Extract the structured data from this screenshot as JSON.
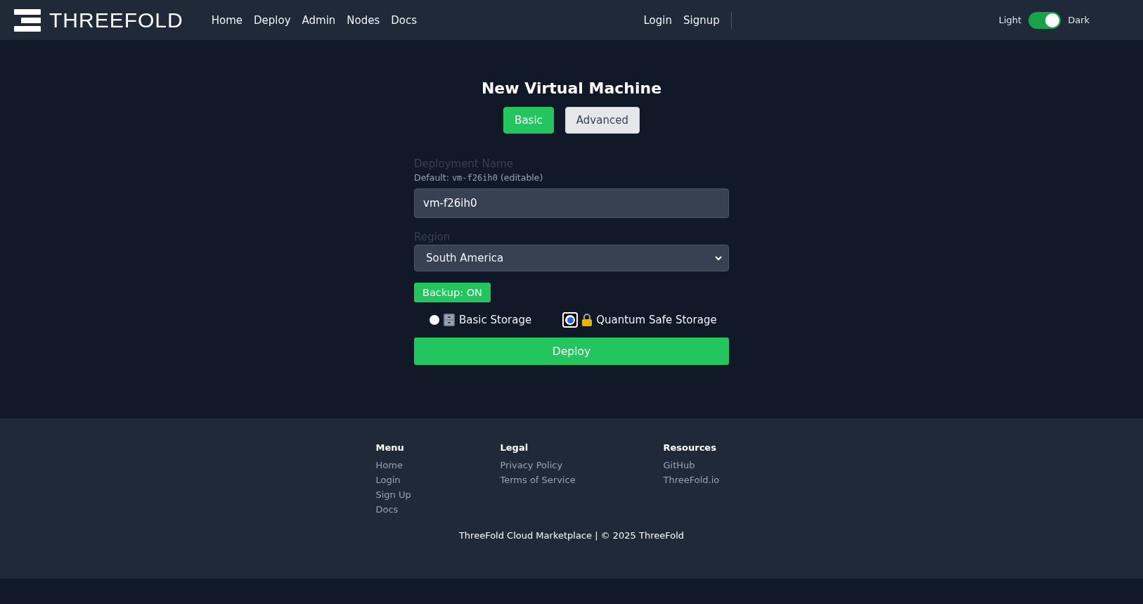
{
  "header": {
    "logo_text": "THREEFOLD",
    "nav": [
      "Home",
      "Deploy",
      "Admin",
      "Nodes",
      "Docs"
    ],
    "auth_links": [
      "Login",
      "Signup"
    ],
    "theme_toggle": {
      "light_label": "Light",
      "dark_label": "Dark",
      "on": true
    }
  },
  "form": {
    "title": "New Virtual Machine",
    "tabs": [
      {
        "label": "Basic",
        "selected": true
      },
      {
        "label": "Advanced",
        "selected": false
      }
    ],
    "deployment_name": {
      "label": "Deployment Name",
      "hint_prefix": "Default:",
      "hint_code": "vm-f26ih0",
      "hint_suffix": "(editable)",
      "value": "vm-f26ih0"
    },
    "region": {
      "label": "Region",
      "value": "South America"
    },
    "backup": {
      "label": "Backup: ON",
      "on": true
    },
    "storage_options": [
      {
        "kind": "cabinet",
        "label": "Basic Storage",
        "selected": false
      },
      {
        "kind": "lock",
        "label": "Quantum Safe Storage",
        "selected": true
      }
    ],
    "deploy_button": "Deploy"
  },
  "footer": {
    "columns": [
      {
        "heading": "Menu",
        "links": [
          "Home",
          "Login",
          "Sign Up",
          "Docs"
        ]
      },
      {
        "heading": "Legal",
        "links": [
          "Privacy Policy",
          "Terms of Service"
        ]
      },
      {
        "heading": "Resources",
        "links": [
          "GitHub",
          "ThreeFold.io"
        ]
      }
    ],
    "copyright": "ThreeFold Cloud Marketplace | © 2025 ThreeFold"
  }
}
